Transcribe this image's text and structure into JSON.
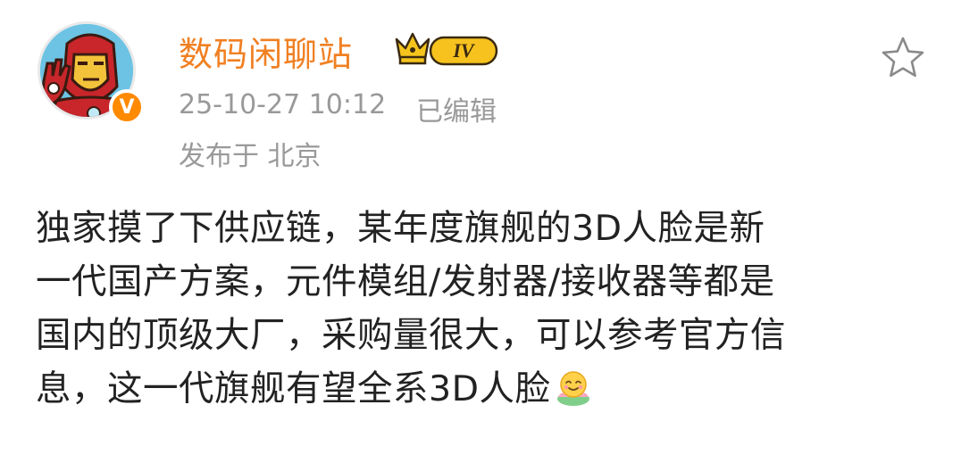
{
  "post": {
    "username": "数码闲聊站",
    "level_badge": "IV",
    "timestamp": "25-10-27 10:12",
    "edited_label": "已编辑",
    "location": "发布于 北京",
    "body_lines": [
      "独家摸了下供应链，某年度旗舰的3D人脸是新",
      "一代国产方案，元件模组/发射器/接收器等都是",
      "国内的顶级大厂，采购量很大，可以参考官方信",
      "息，这一代旗舰有望全系3D人脸"
    ]
  },
  "icons": {
    "avatar": "iron-man-avatar",
    "verified": "verified-v-badge-icon",
    "crown": "crown-icon",
    "favorite": "star-outline-icon",
    "emoji": "smiling-lotus-emoji-icon"
  },
  "colors": {
    "username": "#f08022",
    "meta": "#999999",
    "body": "#222222",
    "verified_badge": "#ff8a00",
    "avatar_bg": "#6cc3e3"
  }
}
